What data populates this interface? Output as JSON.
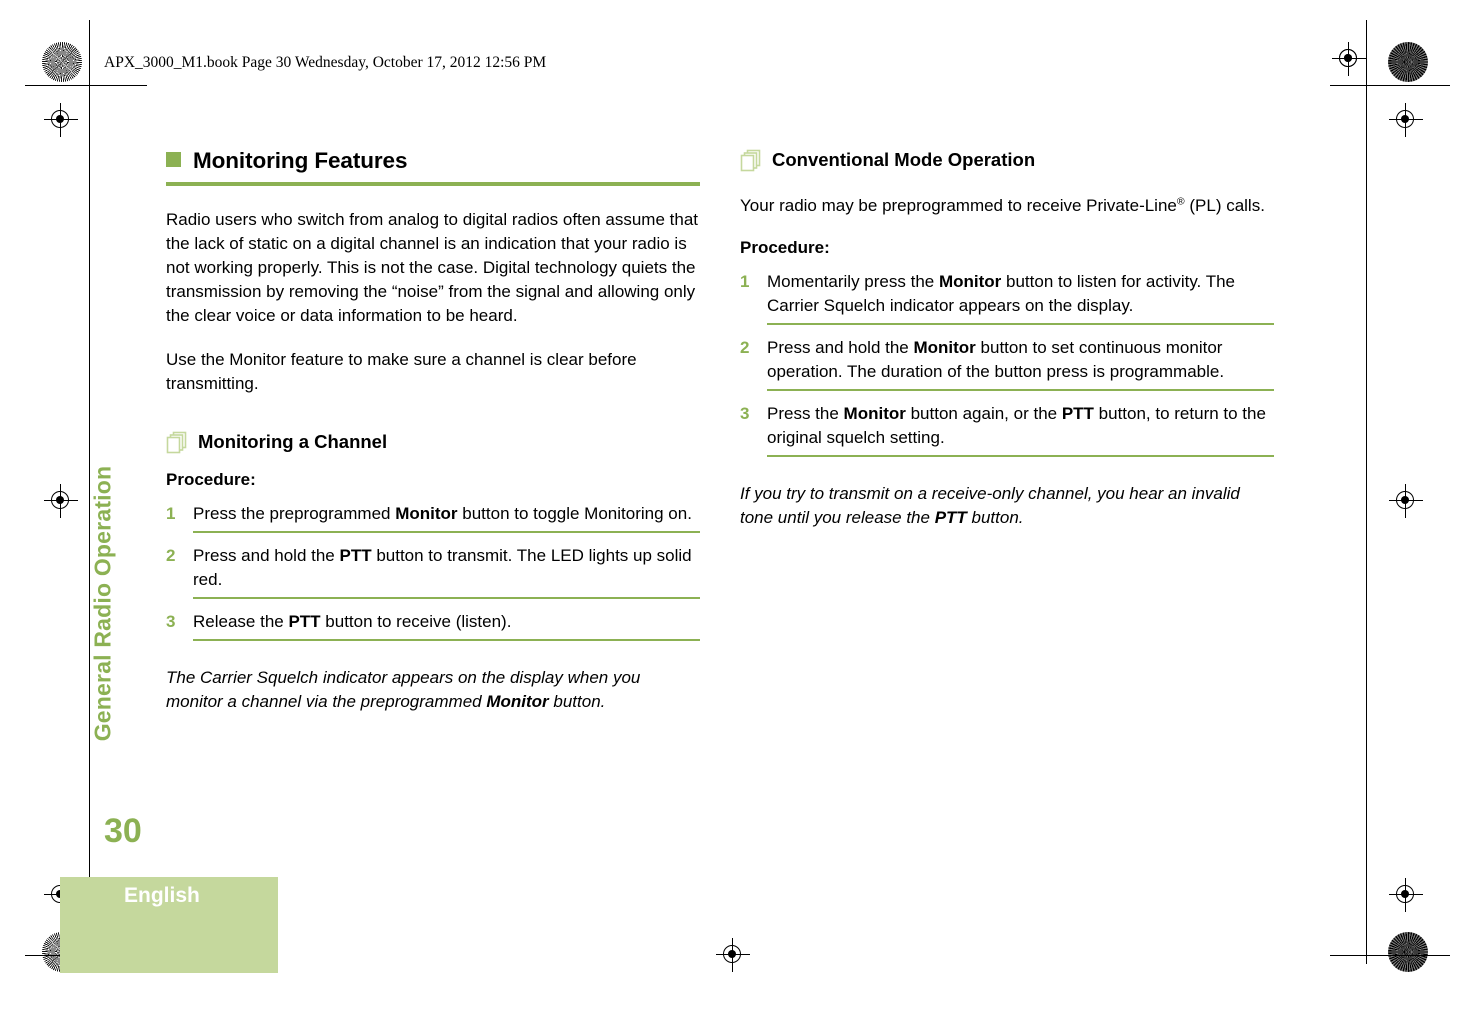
{
  "header": {
    "slug": "APX_3000_M1.book  Page 30  Wednesday, October 17, 2012  12:56 PM"
  },
  "chapter_tab": {
    "label": "General Radio Operation"
  },
  "colors": {
    "accent_green": "#8CB153",
    "tab_green": "#C5D89D",
    "text": "#000000"
  },
  "left_column": {
    "section": {
      "title": "Monitoring Features",
      "bullet_icon": "green-square-bullet"
    },
    "intro_paragraphs": [
      "Radio users who switch from analog to digital radios often assume that the lack of static on a digital channel is an indication that your radio is not working properly. This is not the case. Digital technology quiets the transmission by removing the “noise” from the signal and allowing only the clear voice or data information to be heard.",
      "Use the Monitor feature to make sure a channel is clear before transmitting."
    ],
    "subsection": {
      "icon": "stacked-pages-icon",
      "title": "Monitoring a Channel",
      "procedure_label": "Procedure:",
      "steps": [
        {
          "number": "1",
          "parts": [
            {
              "text": "Press the preprogrammed ",
              "bold": false
            },
            {
              "text": "Monitor",
              "bold": true
            },
            {
              "text": " button to toggle Monitoring on.",
              "bold": false
            }
          ]
        },
        {
          "number": "2",
          "parts": [
            {
              "text": "Press and hold the ",
              "bold": false
            },
            {
              "text": "PTT",
              "bold": true
            },
            {
              "text": " button to transmit. The LED lights up solid red.",
              "bold": false
            }
          ]
        },
        {
          "number": "3",
          "parts": [
            {
              "text": "Release the ",
              "bold": false
            },
            {
              "text": "PTT",
              "bold": true
            },
            {
              "text": " button to receive (listen).",
              "bold": false
            }
          ]
        }
      ]
    },
    "note": {
      "parts": [
        {
          "text": "The Carrier Squelch indicator appears on the display when you monitor a channel via the preprogrammed ",
          "bold": false
        },
        {
          "text": "Monitor",
          "bold": true
        },
        {
          "text": " button.",
          "bold": false
        }
      ]
    }
  },
  "right_column": {
    "subsection": {
      "icon": "stacked-pages-icon",
      "title": "Conventional Mode Operation"
    },
    "intro_parts": [
      {
        "text": "Your radio may be preprogrammed to receive Private-Line",
        "bold": false
      },
      {
        "text": "®",
        "bold": false,
        "sup": true
      },
      {
        "text": " (PL) calls.",
        "bold": false
      }
    ],
    "procedure_label": "Procedure:",
    "steps": [
      {
        "number": "1",
        "parts": [
          {
            "text": "Momentarily press the ",
            "bold": false
          },
          {
            "text": "Monitor",
            "bold": true
          },
          {
            "text": " button to listen for activity. The Carrier Squelch indicator appears on the display.",
            "bold": false
          }
        ]
      },
      {
        "number": "2",
        "parts": [
          {
            "text": "Press and hold the ",
            "bold": false
          },
          {
            "text": "Monitor",
            "bold": true
          },
          {
            "text": " button to set continuous monitor operation. The duration of the button press is programmable.",
            "bold": false
          }
        ]
      },
      {
        "number": "3",
        "parts": [
          {
            "text": "Press the ",
            "bold": false
          },
          {
            "text": "Monitor",
            "bold": true
          },
          {
            "text": " button again, or the ",
            "bold": false
          },
          {
            "text": "PTT",
            "bold": true
          },
          {
            "text": " button, to return to the original squelch setting.",
            "bold": false
          }
        ]
      }
    ],
    "note": {
      "parts": [
        {
          "text": "If you try to transmit on a receive-only channel, you hear an invalid tone until you release the ",
          "bold": false
        },
        {
          "text": "PTT",
          "bold": true
        },
        {
          "text": " button.",
          "bold": false
        }
      ]
    }
  },
  "footer": {
    "page_number": "30",
    "language": "English"
  }
}
